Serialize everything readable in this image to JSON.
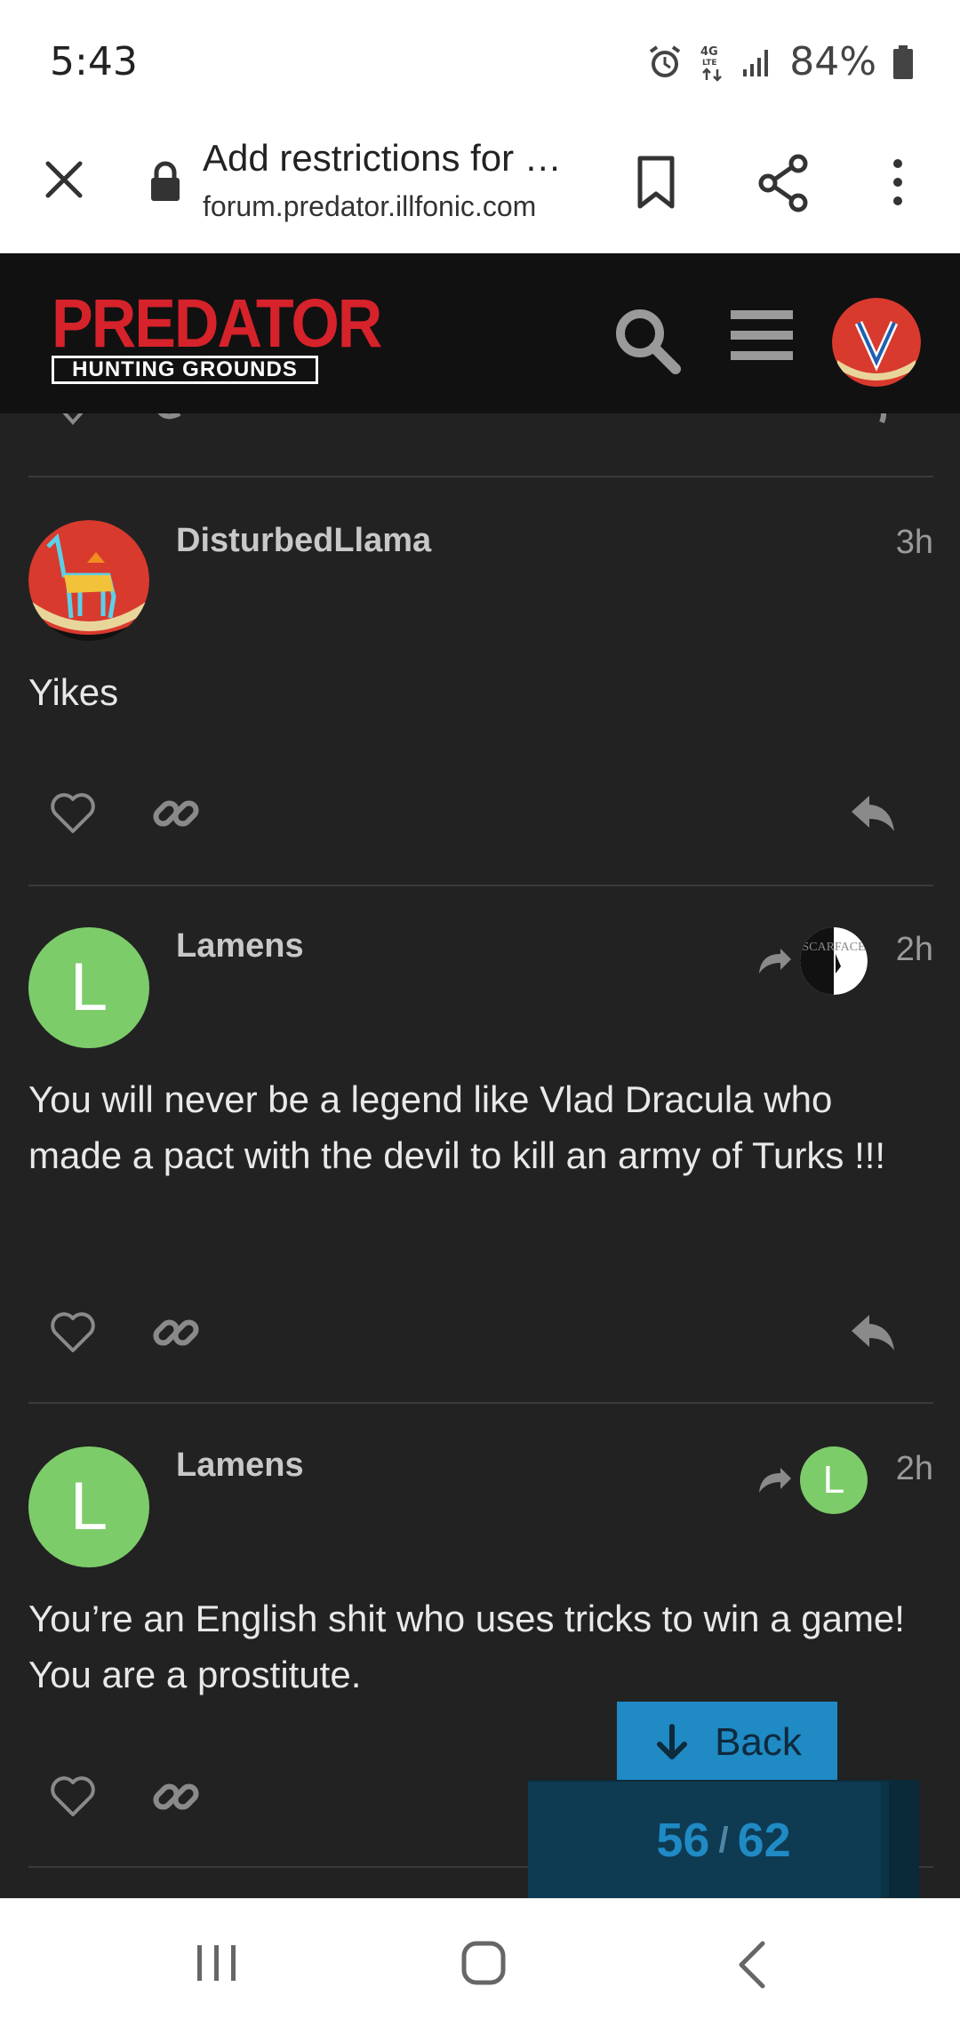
{
  "status_bar": {
    "time": "5:43",
    "network": "4G LTE",
    "battery": "84%"
  },
  "browser": {
    "page_title": "Add restrictions for …",
    "domain": "forum.predator.illfonic.com"
  },
  "header": {
    "logo_top": "PREDATOR",
    "logo_bottom": "HUNTING GROUNDS"
  },
  "posts": [
    {
      "username": "DisturbedLlama",
      "time": "3h",
      "body": "Yikes"
    },
    {
      "username": "Lamens",
      "time": "2h",
      "reply_to_label": "SCARFACE",
      "body": "You will never be a legend like Vlad Dracula who made a pact with the devil to kill an army of Turks !!!"
    },
    {
      "username": "Lamens",
      "avatar_letter": "L",
      "time": "2h",
      "reply_to_letter": "L",
      "body": "You’re an English shit who uses tricks to win a game! You are a prostitute."
    }
  ],
  "post_avatar_letter_2": "L",
  "floating": {
    "back_label": "Back",
    "progress_current": "56",
    "progress_separator": "/",
    "progress_total": "62",
    "progress_fraction": 0.903
  },
  "colors": {
    "background": "#222222",
    "header": "#111111",
    "avatar_green": "#7dcc6a",
    "accent_blue": "#1f8ac4",
    "brand_red": "#d6222a"
  }
}
